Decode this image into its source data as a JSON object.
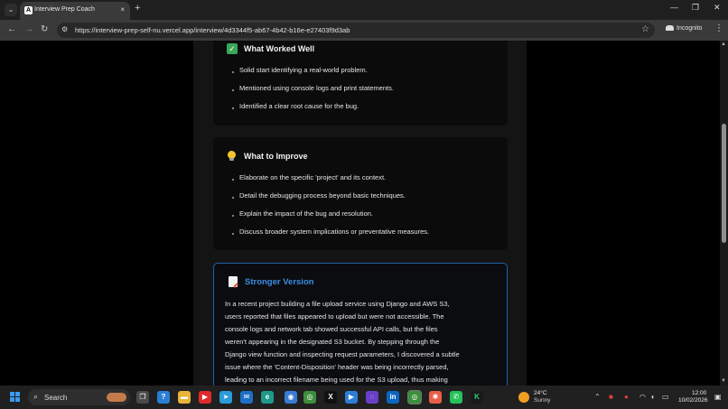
{
  "browser": {
    "tab_title": "Interview Prep Coach",
    "tab_favicon": "A",
    "tab_close": "×",
    "new_tab": "+",
    "url": "https://interview-prep-self-nu.vercel.app/interview/4d3344f5-ab67-4b42-b16e-e27403f9d3ab",
    "profile_label": "Incognito",
    "nav": {
      "back": "←",
      "forward": "→",
      "reload": "↻"
    },
    "window": {
      "minimize": "—",
      "maximize": "❐",
      "close": "✕"
    },
    "star": "☆",
    "menu": "⋮"
  },
  "worked_well": {
    "title": "What Worked Well",
    "icon": "check-mark-icon",
    "items": [
      "Solid start identifying a real-world problem.",
      "Mentioned using console logs and print statements.",
      "Identified a clear root cause for the bug."
    ]
  },
  "improve": {
    "title": "What to Improve",
    "icon": "light-bulb-icon",
    "items": [
      "Elaborate on the specific 'project' and its context.",
      "Detail the debugging process beyond basic techniques.",
      "Explain the impact of the bug and resolution.",
      "Discuss broader system implications or preventative measures."
    ]
  },
  "stronger": {
    "title": "Stronger Version",
    "icon": "memo-icon",
    "lines": [
      "In a recent project building a file upload service using Django and AWS S3,",
      "users reported that files appeared to upload but were not accessible. The",
      "console logs and network tab showed successful API calls, but the files",
      "weren't appearing in the designated S3 bucket. By stepping through the",
      "Django view function and inspecting request parameters, I discovered a subtle",
      "issue where the 'Content-Disposition' header was being incorrectly parsed,",
      "leading to an incorrect filename being used for the S3 upload, thus making"
    ]
  },
  "taskbar": {
    "search_label": "Search",
    "weather_temp": "24°C",
    "weather_desc": "Sunny",
    "time": "12:00",
    "date": "10/02/2026"
  },
  "colors": {
    "accent_blue": "#3b8de0",
    "check_green": "#3aa757",
    "bulb_yellow": "#f4c430"
  }
}
